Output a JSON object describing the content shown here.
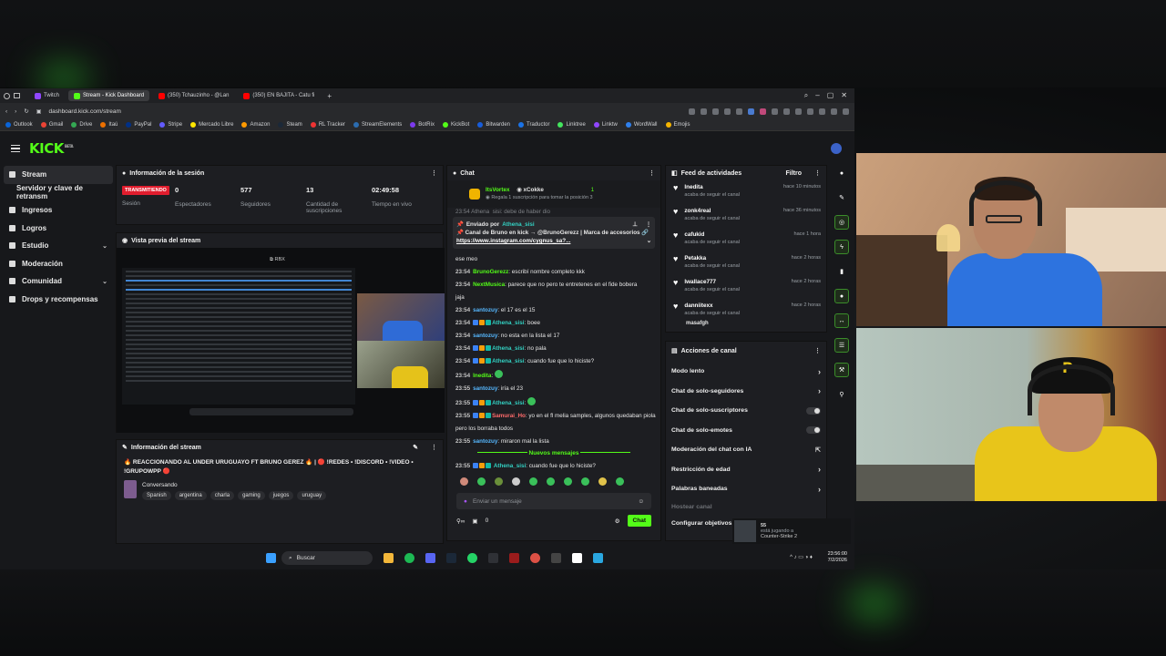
{
  "browser": {
    "tabs": [
      {
        "label": "Twitch",
        "color": "#9147ff",
        "active": false
      },
      {
        "label": "Stream - Kick Dashboard",
        "color": "#53fc18",
        "active": true
      },
      {
        "label": "(350) Tchauzinho - @Lan",
        "color": "#ff0000",
        "active": false
      },
      {
        "label": "(350) EN BAJITA - Catu fi",
        "color": "#ff0000",
        "active": false
      }
    ],
    "new_tab": "+",
    "url": "dashboard.kick.com/stream",
    "bookmarks": [
      "Outlook",
      "Gmail",
      "Drive",
      "Itaú",
      "PayPal",
      "Stripe",
      "Mercado Libre",
      "Amazon",
      "Steam",
      "RL Tracker",
      "StreamElements",
      "BotRix",
      "KickBot",
      "Bitwarden",
      "Traductor",
      "Linktree",
      "Linktw",
      "WordWall",
      "Emojis"
    ]
  },
  "kick": {
    "logo": "KICK",
    "logo_tag": "BETA"
  },
  "sidebar": {
    "items": [
      {
        "label": "Stream",
        "active": true
      },
      {
        "label": "Servidor y clave de retransm",
        "sub": true
      },
      {
        "label": "Ingresos"
      },
      {
        "label": "Logros"
      },
      {
        "label": "Estudio",
        "chevron": "⌄"
      },
      {
        "label": "Moderación"
      },
      {
        "label": "Comunidad",
        "chevron": "⌄"
      },
      {
        "label": "Drops y recompensas"
      }
    ]
  },
  "session": {
    "title": "Información de la sesión",
    "live_badge": "TRANSMITIENDO",
    "session_label": "Sesión",
    "stats": [
      {
        "value": "0",
        "label": "Espectadores"
      },
      {
        "value": "577",
        "label": "Seguidores"
      },
      {
        "value": "13",
        "label": "Cantidad de suscripciones"
      },
      {
        "value": "02:49:58",
        "label": "Tiempo en vivo"
      }
    ]
  },
  "preview": {
    "title": "Vista previa del stream",
    "window_label": "RBX"
  },
  "stream_info": {
    "title": "Información del stream",
    "stream_title": "🔥 REACCIONANDO AL UNDER URUGUAYO FT BRUNO GEREZ 🔥 | 🔴 !REDES • !DISCORD • !VIDEO • !GRUPOWPP 🔴",
    "category": "Conversando",
    "tags": [
      "Spanish",
      "argentina",
      "charla",
      "gaming",
      "juegos",
      "uruguay"
    ]
  },
  "chat": {
    "title": "Chat",
    "gift_user": "ItsVortex",
    "gift_user2": "xCokke",
    "gift_count": "1",
    "gift_text": "Regala 1 suscripción para tomar la posición 3",
    "partial_line": "23:54 Athena_sisi: debe de haber dio",
    "pinned_by_label": "Enviado por",
    "pinned_by": "Athena_sisi",
    "pinned_text": "📌 Canal de Bruno en kick → @BrunoGerezz | Marca de accesorios 🔗 ",
    "pinned_link": "https://www.instagram.com/cygnus_sa?...",
    "messages": [
      {
        "time": "",
        "user": "",
        "text": "ese meo",
        "color": ""
      },
      {
        "time": "23:54",
        "user": "BrunoGerezz",
        "text": "escribí nombre completo kkk",
        "color": "green"
      },
      {
        "time": "23:54",
        "user": "NextMusica",
        "text": "parece que no pero te entretenes en el fide bobera",
        "color": "green"
      },
      {
        "time": "",
        "user": "",
        "text": "jaja",
        "color": ""
      },
      {
        "time": "23:54",
        "user": "santozuy",
        "text": "el 17 es el 15",
        "color": "blue"
      },
      {
        "time": "23:54",
        "user": "Athena_sisi",
        "text": "boee",
        "color": "teal"
      },
      {
        "time": "23:54",
        "user": "santozuy",
        "text": "no esta en la lista el 17",
        "color": "blue"
      },
      {
        "time": "23:54",
        "user": "Athena_sisi",
        "text": "no pala",
        "color": "teal"
      },
      {
        "time": "23:54",
        "user": "Athena_sisi",
        "text": "cuando fue que lo hiciste?",
        "color": "teal"
      },
      {
        "time": "23:54",
        "user": "Inedita",
        "text": "",
        "color": "green"
      },
      {
        "time": "23:55",
        "user": "santozuy",
        "text": "iría el 23",
        "color": "blue"
      },
      {
        "time": "23:55",
        "user": "Athena_sisi",
        "text": "",
        "color": "teal"
      },
      {
        "time": "23:55",
        "user": "Samurai_Ho",
        "text": "yo en el fl melia samples, algunos quedaban piola",
        "color": "red"
      },
      {
        "time": "",
        "user": "",
        "text": "pero los borraba todos",
        "color": ""
      },
      {
        "time": "23:55",
        "user": "santozuy",
        "text": "miraron mal la lista",
        "color": "blue"
      }
    ],
    "new_messages": "Nuevos mensajes",
    "last_message": {
      "time": "23:55",
      "user": "Athena_sisi",
      "text": "cuando fue que lo hiciste?"
    },
    "input_placeholder": "Enviar un mensaje",
    "send_label": "Chat",
    "points": "0"
  },
  "activity": {
    "title": "Feed de actividades",
    "filter": "Filtro",
    "items": [
      {
        "name": "Inedita",
        "action": "acaba de seguir el canal",
        "time": "hace 10 minutos"
      },
      {
        "name": "zonk4real",
        "action": "acaba de seguir el canal",
        "time": "hace 36 minutos"
      },
      {
        "name": "cafukid",
        "action": "acaba de seguir el canal",
        "time": "hace 1 hora"
      },
      {
        "name": "Petakka",
        "action": "acaba de seguir el canal",
        "time": "hace 2 horas"
      },
      {
        "name": "lwallace777",
        "action": "acaba de seguir el canal",
        "time": "hace 2 horas"
      },
      {
        "name": "danniitexx",
        "action": "acaba de seguir el canal",
        "time": "hace 2 horas"
      }
    ],
    "partial": "masafgh"
  },
  "channel_actions": {
    "title": "Acciones de canal",
    "rows": [
      {
        "label": "Modo lento",
        "control": "arrow"
      },
      {
        "label": "Chat de solo-seguidores",
        "control": "arrow"
      },
      {
        "label": "Chat de solo-suscriptores",
        "control": "toggle"
      },
      {
        "label": "Chat de solo-emotes",
        "control": "toggle"
      },
      {
        "label": "Moderación del chat con IA",
        "control": "ext"
      },
      {
        "label": "Restricción de edad",
        "control": "arrow"
      },
      {
        "label": "Palabras baneadas",
        "control": "arrow"
      }
    ],
    "host_label": "Hostear canal",
    "goals_label": "Configurar objetivos"
  },
  "mini_overlay": {
    "count": "55",
    "line1": "está jugando a",
    "line2": "Counter-Strike 2"
  },
  "taskbar": {
    "search": "Buscar",
    "time": "23:56:00",
    "date": "7/2/2026"
  },
  "colors": {
    "kick_green": "#53fc18",
    "live_red": "#e11d2e"
  }
}
